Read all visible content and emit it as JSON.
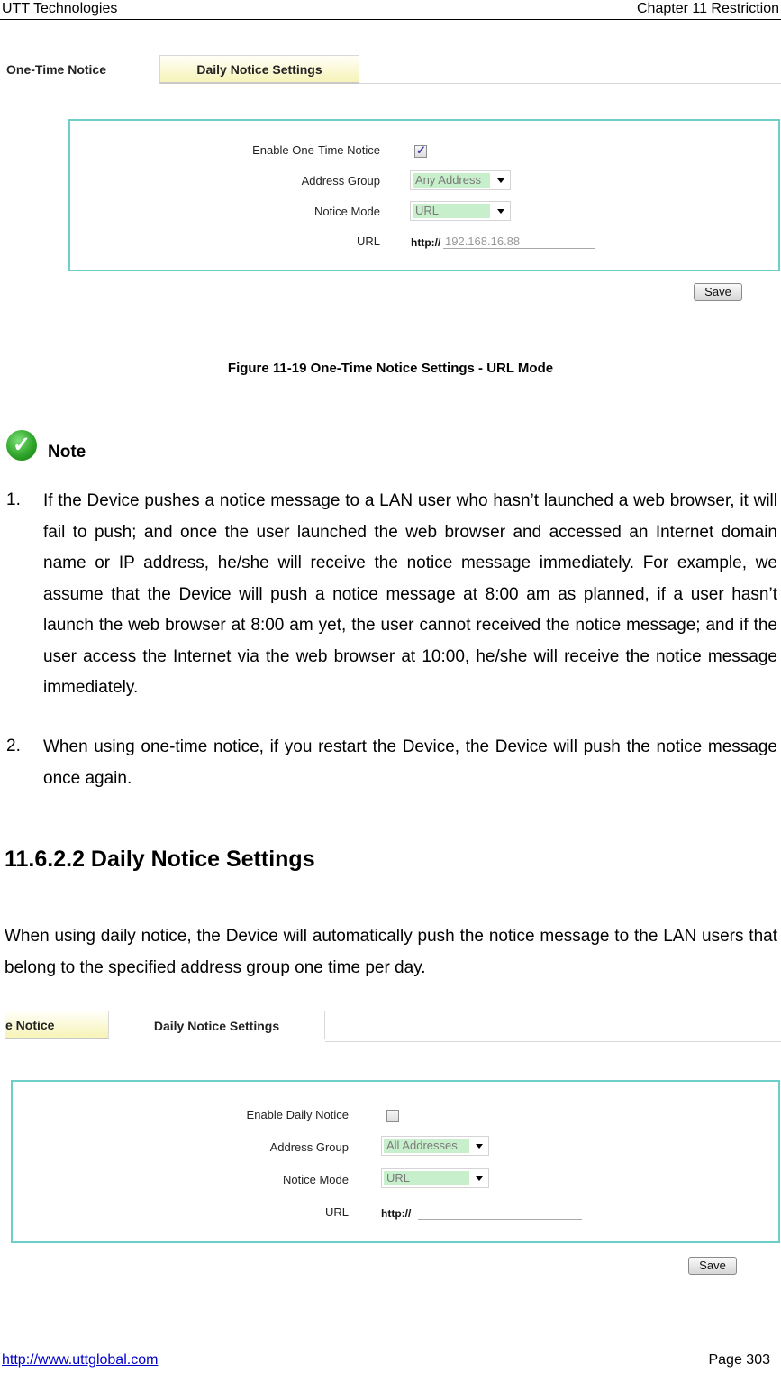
{
  "header": {
    "left": "UTT Technologies",
    "right": "Chapter 11 Restriction"
  },
  "footer": {
    "link": "http://www.uttglobal.com",
    "page": "Page  303"
  },
  "figure1": {
    "tabs": [
      {
        "label": "One-Time Notice",
        "active": true
      },
      {
        "label": "Daily Notice Settings",
        "active": false
      }
    ],
    "fields": {
      "enable_label": "Enable One-Time Notice",
      "enable_checked": true,
      "address_group_label": "Address Group",
      "address_group_value": "Any Address",
      "notice_mode_label": "Notice Mode",
      "notice_mode_value": "URL",
      "url_label": "URL",
      "url_prefix": "http://",
      "url_value": "192.168.16.88"
    },
    "save_label": "Save",
    "caption": "Figure 11-19 One-Time Notice Settings - URL Mode"
  },
  "note": {
    "icon": "green-check-icon",
    "title": "Note",
    "items": [
      {
        "number": "1.",
        "text": "If the Device pushes a notice message to a LAN user who hasn’t launched a web browser, it will fail to push; and once the user launched the web browser and accessed an Internet domain name or IP address, he/she will receive the notice message immediately. For example, we assume that the Device will push a notice message at 8:00 am as planned, if a user hasn’t launch the web browser at 8:00 am yet, the user cannot received the notice message; and if the user access the Internet via the web browser at 10:00, he/she will receive the notice message immediately."
      },
      {
        "number": "2.",
        "text": "When using one-time notice, if you restart the Device, the Device will push the notice message once again."
      }
    ]
  },
  "section": {
    "heading": "11.6.2.2 Daily Notice Settings",
    "body": "When using daily notice, the Device will automatically push the notice message to the LAN users that belong to the specified address group one time per day."
  },
  "figure2": {
    "tabs": [
      {
        "label": "e Notice",
        "active": false
      },
      {
        "label": "Daily Notice Settings",
        "active": true
      }
    ],
    "fields": {
      "enable_label": "Enable Daily Notice",
      "enable_checked": false,
      "address_group_label": "Address Group",
      "address_group_value": "All Addresses",
      "notice_mode_label": "Notice Mode",
      "notice_mode_value": "URL",
      "url_label": "URL",
      "url_prefix": "http://",
      "url_value": ""
    },
    "save_label": "Save"
  }
}
